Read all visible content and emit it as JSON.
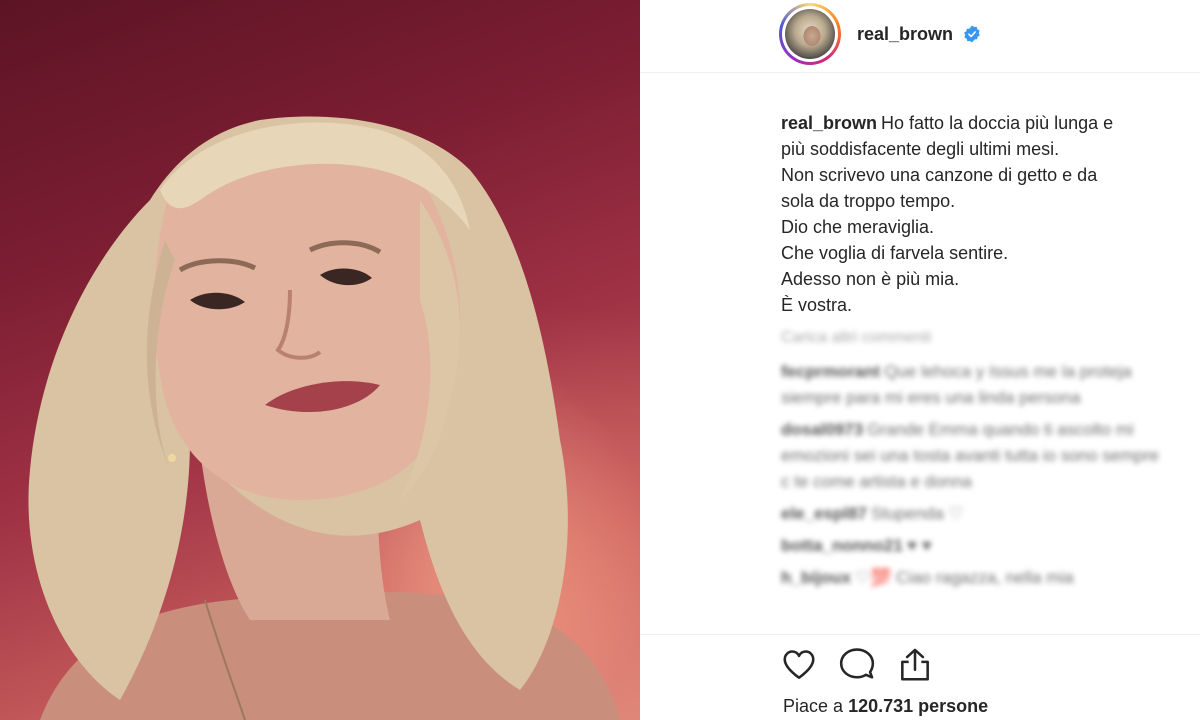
{
  "post": {
    "username": "real_brown",
    "verified": true,
    "photo_alt": "selfie"
  },
  "caption": {
    "username": "real_brown",
    "lines": [
      "Ho fatto la doccia più lunga e",
      "più soddisfacente degli ultimi mesi.",
      "Non scrivevo una canzone di getto e da",
      "sola da troppo tempo.",
      "Dio che meraviglia.",
      "Che voglia di farvela sentire.",
      "Adesso non è più mia.",
      "È vostra."
    ]
  },
  "comments": {
    "load_more_label": "Carica altri commenti",
    "items": [
      {
        "user": "fecprmorant",
        "text": "Que lehoca y Issus me la proteja siempre para mi eres una linda persona"
      },
      {
        "user": "dosal0973",
        "text": "Grande Emma quando ti ascolto mi emozioni sei una tosta avanti tutta io sono sempre c te come artista e donna"
      },
      {
        "user": "ele_espl87",
        "text": "Stupenda ♡"
      },
      {
        "user": "botta_nonno21",
        "text": "♥ ♥"
      },
      {
        "user": "h_bijoux",
        "text": "♡💯 Ciao ragazza, nella mia"
      }
    ]
  },
  "actions": {
    "like_label": "Mi piace",
    "comment_label": "Commenta",
    "share_label": "Condividi"
  },
  "likes": {
    "prefix": "Piace a",
    "count": "120.731",
    "suffix": "persone"
  },
  "colors": {
    "verified": "#3897f0",
    "text": "#262626",
    "divider": "#efefef"
  }
}
